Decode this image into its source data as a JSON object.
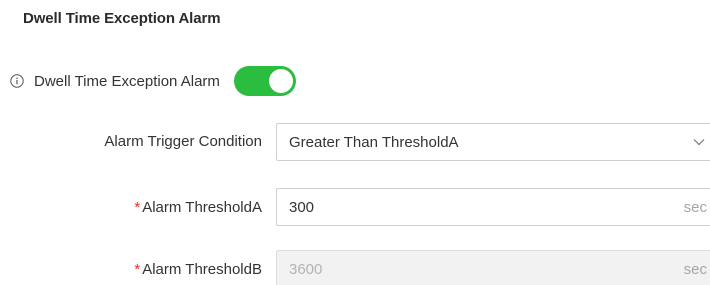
{
  "section": {
    "title": "Dwell Time Exception Alarm"
  },
  "toggle": {
    "label": "Dwell Time Exception Alarm",
    "icon": "info-icon",
    "enabled": true,
    "color": "#2bbd3f"
  },
  "fields": {
    "trigger": {
      "label": "Alarm Trigger Condition",
      "value": "Greater Than ThresholdA",
      "icon": "chevron-down-icon"
    },
    "threshold_a": {
      "required_mark": "*",
      "label": "Alarm ThresholdA",
      "value": "300",
      "unit": "sec"
    },
    "threshold_b": {
      "required_mark": "*",
      "label": "Alarm ThresholdB",
      "value": "3600",
      "unit": "sec",
      "disabled": true
    }
  },
  "colors": {
    "required": "#e0312b",
    "accent_green": "#2bbd3f"
  }
}
